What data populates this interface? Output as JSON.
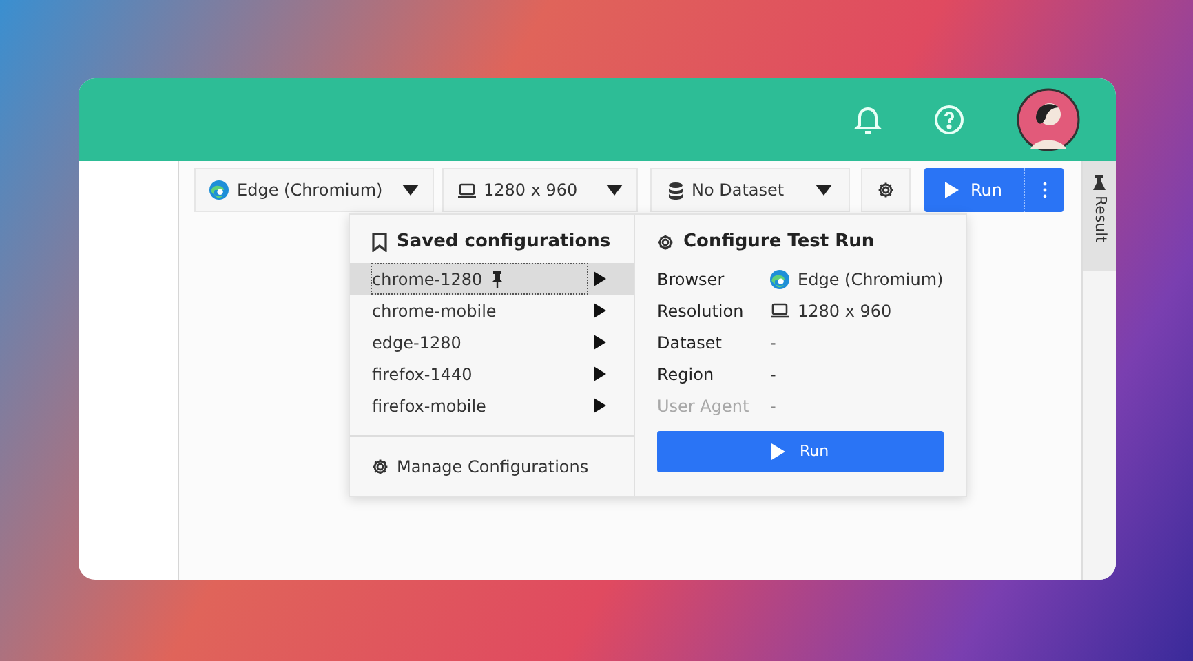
{
  "toolbar": {
    "browser": {
      "label": "Edge (Chromium)"
    },
    "resolution": {
      "label": "1280 x 960"
    },
    "dataset": {
      "label": "No Dataset"
    },
    "run_button": {
      "label": "Run"
    }
  },
  "side_tab": {
    "label": "Result"
  },
  "saved_configurations": {
    "title": "Saved configurations",
    "items": [
      {
        "label": "chrome-1280",
        "pinned": true,
        "selected": true
      },
      {
        "label": "chrome-mobile",
        "pinned": false,
        "selected": false
      },
      {
        "label": "edge-1280",
        "pinned": false,
        "selected": false
      },
      {
        "label": "firefox-1440",
        "pinned": false,
        "selected": false
      },
      {
        "label": "firefox-mobile",
        "pinned": false,
        "selected": false
      }
    ],
    "manage": {
      "label": "Manage Configurations"
    }
  },
  "configure": {
    "title": "Configure Test Run",
    "fields": [
      {
        "label": "Browser",
        "value": "Edge (Chromium)",
        "kind": "browser",
        "disabled": false
      },
      {
        "label": "Resolution",
        "value": "1280 x 960",
        "kind": "resolution",
        "disabled": false
      },
      {
        "label": "Dataset",
        "value": "-",
        "kind": "text",
        "disabled": false
      },
      {
        "label": "Region",
        "value": "-",
        "kind": "text",
        "disabled": false
      },
      {
        "label": "User Agent",
        "value": "-",
        "kind": "text",
        "disabled": true
      }
    ],
    "run_button": {
      "label": "Run"
    }
  }
}
